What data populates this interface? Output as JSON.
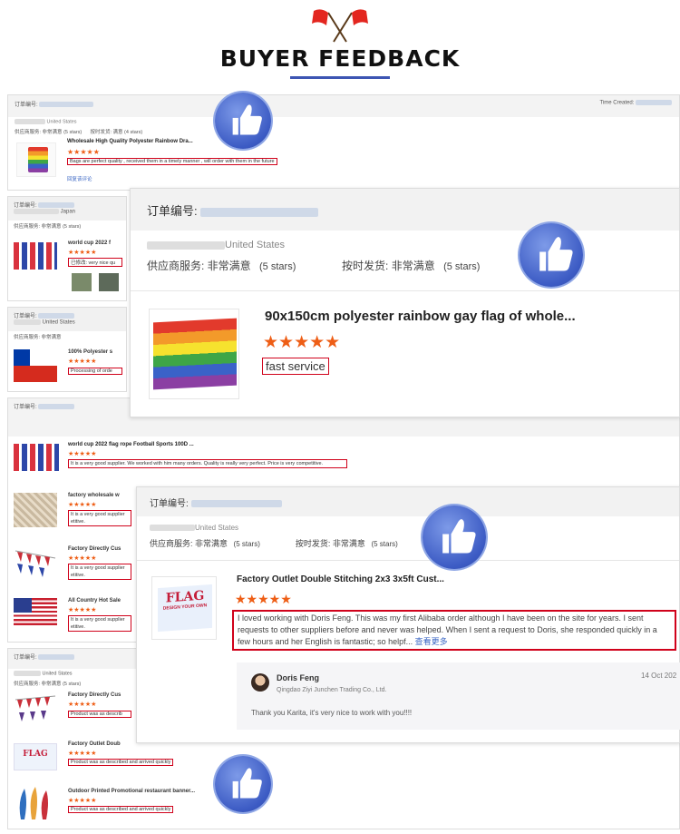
{
  "header": {
    "title": "BUYER FEEDBACK"
  },
  "colors": {
    "accent": "#3d55b3",
    "star": "#ee5e16",
    "highlight": "#d0021b"
  },
  "background_list": {
    "top": {
      "order_label": "订单编号:",
      "country": "United States",
      "supplier_service": "供应商服务: 非常满意",
      "supplier_stars": "(5 stars)",
      "on_time": "按时发货: 满意",
      "on_time_stars": "(4 stars)",
      "time_label": "Time Created:",
      "product": "Wholesale High Quality Polyester Rainbow Dra...",
      "stars": "★★★★★",
      "comment": "Bags are perfect quality , received them in a timely manner , will order with them in the future",
      "translate_link": "回复该评论"
    },
    "second": {
      "order_label": "订单编号:",
      "country": "Japan",
      "supplier_service": "供应商服务: 非常满意",
      "supplier_stars": "(5 stars)",
      "product": "world cup 2022 f",
      "stars": "★★★★★",
      "comment": "已修改: very nice qu"
    },
    "third": {
      "order_label": "订单编号:",
      "country": "United States",
      "supplier_service": "供应商服务: 非常满意",
      "product": "100% Polyester s",
      "stars": "★★★★★",
      "comment": "Processing of orde"
    },
    "fourth": {
      "order_label": "订单编号:",
      "product": "world cup 2022 flag rope Football Sports 100D ...",
      "stars": "★★★★★",
      "comment": "It is a very good supplier. We worked with him many orders. Quality is really very perfect. Price is very competitive."
    },
    "mini_items": [
      {
        "product": "factory wholesale w",
        "stars": "★★★★★",
        "comment": "It is a very good supplier etitive."
      },
      {
        "product": "Factory Directly Cus",
        "stars": "★★★★★",
        "comment": "It is a very good supplier etitive."
      },
      {
        "product": "All Country Hot Sale",
        "stars": "★★★★★",
        "comment": "It is a very good supplier etitive."
      }
    ],
    "bottom": {
      "order_label": "订单编号:",
      "country": "United States",
      "supplier_service": "供应商服务: 非常满意",
      "supplier_stars": "(5 stars)",
      "items": [
        {
          "product": "Factory Directly Cus",
          "stars": "★★★★★",
          "comment": "Product was as describ"
        },
        {
          "product": "Factory Outlet Doub",
          "stars": "★★★★★",
          "comment": "Product was as described and arrived quickly"
        },
        {
          "product": "Outdoor Printed Promotional restaurant banner...",
          "stars": "★★★★★",
          "comment": "Product was as described and arrived quickly"
        }
      ]
    }
  },
  "card1": {
    "order_label": "订单编号:",
    "country": "United States",
    "supplier_service": "供应商服务: 非常满意",
    "supplier_stars": "(5 stars)",
    "on_time": "按时发货: 非常满意",
    "on_time_stars": "(5 stars)",
    "product": "90x150cm polyester rainbow gay flag of whole...",
    "stars": "★★★★★",
    "comment": "fast service"
  },
  "card2": {
    "order_label": "订单编号:",
    "country": "United States",
    "supplier_service": "供应商服务: 非常满意",
    "supplier_stars": "(5 stars)",
    "on_time": "按时发货: 非常满意",
    "on_time_stars": "(5 stars)",
    "product": "Factory Outlet Double Stitching 2x3 3x5ft Cust...",
    "stars": "★★★★★",
    "comment": "I loved working with Doris Feng. This was my first Alibaba order although I have been on the site for years. I sent requests to other suppliers before and never was helped. When I sent a request to Doris, she responded quickly in a few hours and her English is fantastic; so helpf...",
    "more_link": "查看更多",
    "flag_text": "FLAG",
    "flag_sub": "DESIGN YOUR OWN",
    "reply": {
      "name": "Doris Feng",
      "company": "Qingdao Ziyi Junchen Trading Co., Ltd.",
      "date": "14 Oct 202",
      "message": "Thank you Karita, it's very nice to work with you!!!!"
    }
  }
}
